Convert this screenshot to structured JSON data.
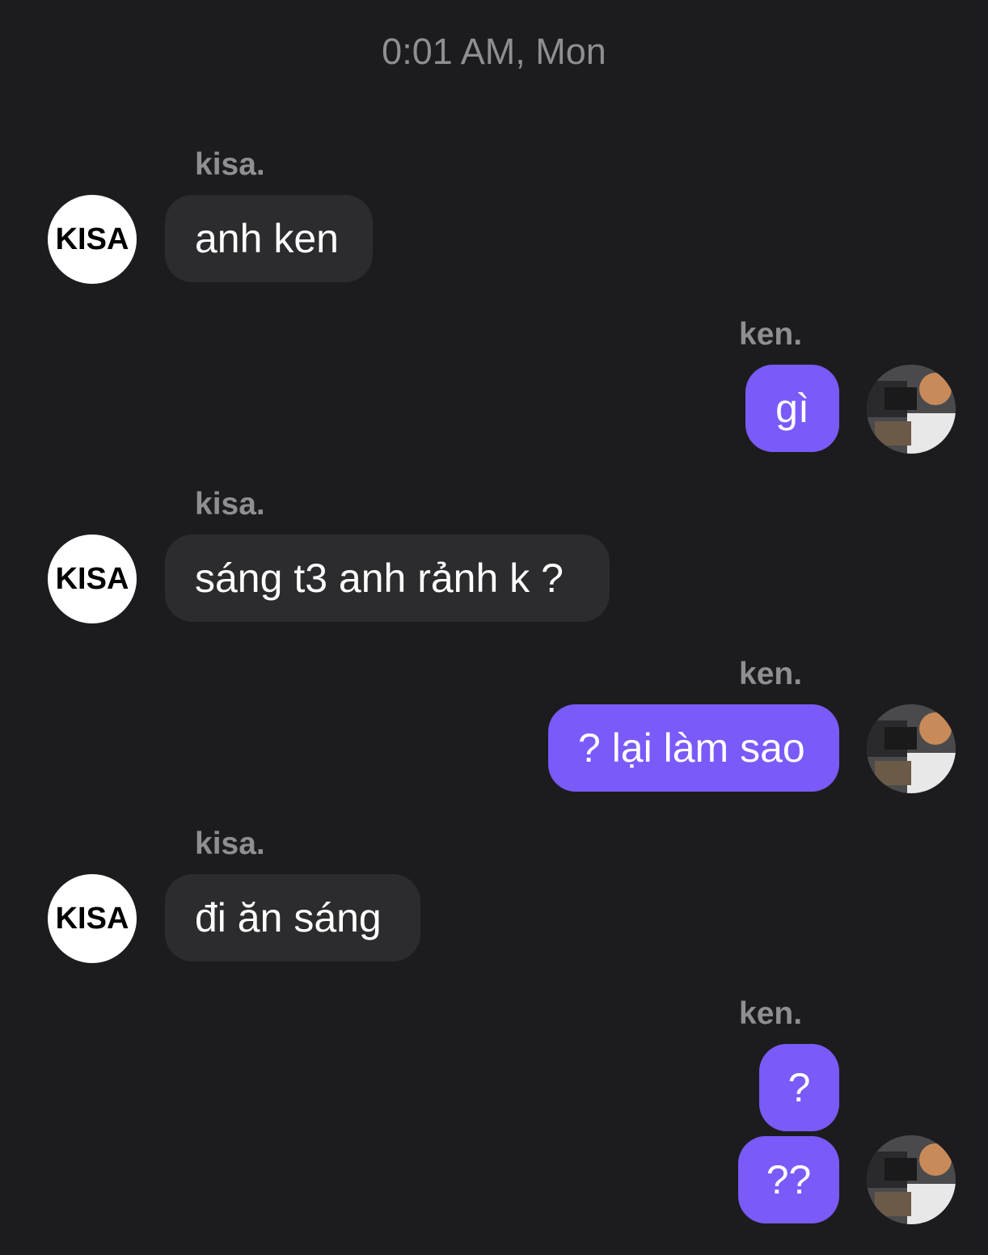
{
  "header": {
    "timestamp": "0:01 AM, Mon"
  },
  "colors": {
    "background": "#1c1c1e",
    "incoming_bubble": "#2c2c2e",
    "outgoing_bubble": "#7a5af8",
    "meta_text": "#8e8e93"
  },
  "messages": [
    {
      "sender": "kisa.",
      "direction": "incoming",
      "text": "anh ken",
      "avatar": "kisa-logo-avatar"
    },
    {
      "sender": "ken.",
      "direction": "outgoing",
      "text": "gì",
      "avatar": "ken-photo-avatar"
    },
    {
      "sender": "kisa.",
      "direction": "incoming",
      "text": "sáng t3 anh rảnh k ?",
      "avatar": "kisa-logo-avatar"
    },
    {
      "sender": "ken.",
      "direction": "outgoing",
      "text": "? lại làm sao",
      "avatar": "ken-photo-avatar"
    },
    {
      "sender": "kisa.",
      "direction": "incoming",
      "text": "đi ăn sáng",
      "avatar": "kisa-logo-avatar"
    },
    {
      "sender": "ken.",
      "direction": "outgoing",
      "text": "?",
      "avatar": null
    },
    {
      "sender": null,
      "direction": "outgoing",
      "text": "??",
      "avatar": "ken-photo-avatar"
    }
  ],
  "kisa_avatar": {
    "logo_text": "KISA"
  }
}
